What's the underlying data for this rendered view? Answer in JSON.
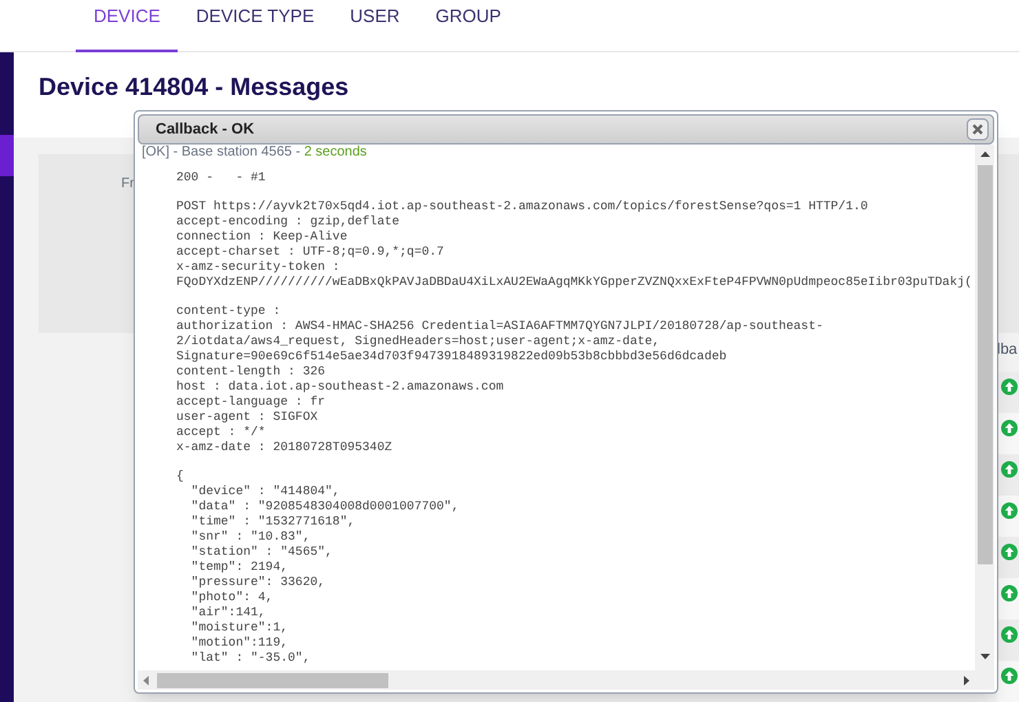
{
  "nav_tabs": [
    {
      "label": "DEVICE",
      "selected": true
    },
    {
      "label": "DEVICE TYPE",
      "selected": false
    },
    {
      "label": "USER",
      "selected": false
    },
    {
      "label": "GROUP",
      "selected": false
    }
  ],
  "page_title": "Device 414804 - Messages",
  "filter_label": "Fr",
  "column_header": "lba",
  "status_rows": [
    {
      "kind": "up"
    },
    {
      "kind": "up"
    },
    {
      "kind": "up"
    },
    {
      "kind": "up"
    },
    {
      "kind": "up"
    },
    {
      "kind": "up"
    },
    {
      "kind": "up"
    },
    {
      "kind": "up"
    }
  ],
  "dialog": {
    "title": "Callback - OK",
    "status": "[OK] - Base station 4565 - ",
    "duration": "2 seconds",
    "blocks": [
      [
        "200 -   - #1"
      ],
      [
        "POST https://ayvk2t70x5qd4.iot.ap-southeast-2.amazonaws.com/topics/forestSense?qos=1 HTTP/1.0",
        "accept-encoding : gzip,deflate",
        "connection : Keep-Alive",
        "accept-charset : UTF-8;q=0.9,*;q=0.7",
        "x-amz-security-token :",
        "FQoDYXdzENP//////////wEaDBxQkPAVJaDBDaU4XiLxAU2EWaAgqMKkYGpperZVZNQxxExFteP4FPVWN0pUdmpeoc85eIibr03puTDakj("
      ],
      [
        "content-type :",
        "authorization : AWS4-HMAC-SHA256 Credential=ASIA6AFTMM7QYGN7JLPI/20180728/ap-southeast-",
        "2/iotdata/aws4_request, SignedHeaders=host;user-agent;x-amz-date,",
        "Signature=90e69c6f514e5ae34d703f9473918489319822ed09b53b8cbbbd3e56d6dcadeb",
        "content-length : 326",
        "host : data.iot.ap-southeast-2.amazonaws.com",
        "accept-language : fr",
        "user-agent : SIGFOX",
        "accept : */*",
        "x-amz-date : 20180728T095340Z"
      ],
      [
        "{",
        "  \"device\" : \"414804\",",
        "  \"data\" : \"9208548304008d0001007700\",",
        "  \"time\" : \"1532771618\",",
        "  \"snr\" : \"10.83\",",
        "  \"station\" : \"4565\",",
        "  \"temp\": 2194,",
        "  \"pressure\": 33620,",
        "  \"photo\": 4,",
        "  \"air\":141,",
        "  \"moisture\":1,",
        "  \"motion\":119,",
        "  \"lat\" : \"-35.0\","
      ]
    ]
  }
}
